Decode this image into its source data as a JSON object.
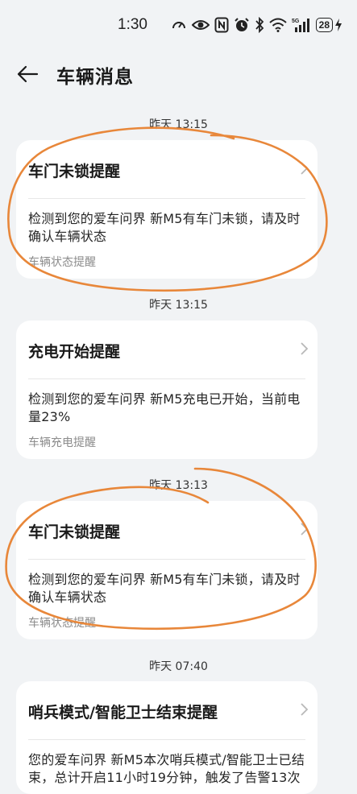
{
  "status_bar": {
    "time": "1:30",
    "signal_label": "5G",
    "battery": "28"
  },
  "header": {
    "title": "车辆消息",
    "back_icon": "arrow-left-icon"
  },
  "messages": [
    {
      "time": "昨天 13:15",
      "title": "车门未锁提醒",
      "body": "检测到您的爱车问界 新M5有车门未锁，请及时确认车辆状态",
      "category": "车辆状态提醒"
    },
    {
      "time": "昨天 13:15",
      "title": "充电开始提醒",
      "body": "检测到您的爱车问界 新M5充电已开始，当前电量23%",
      "category": "车辆充电提醒"
    },
    {
      "time": "昨天 13:13",
      "title": "车门未锁提醒",
      "body": "检测到您的爱车问界 新M5有车门未锁，请及时确认车辆状态",
      "category": "车辆状态提醒"
    },
    {
      "time": "昨天 07:40",
      "title": "哨兵模式/智能卫士结束提醒",
      "body": "您的爱车问界 新M5本次哨兵模式/智能卫士已结束，总计开启11小时19分钟，触发了告警13次",
      "category": ""
    }
  ],
  "colors": {
    "background": "#f1f3f5",
    "card": "#ffffff",
    "annotation": "#e8873a"
  }
}
